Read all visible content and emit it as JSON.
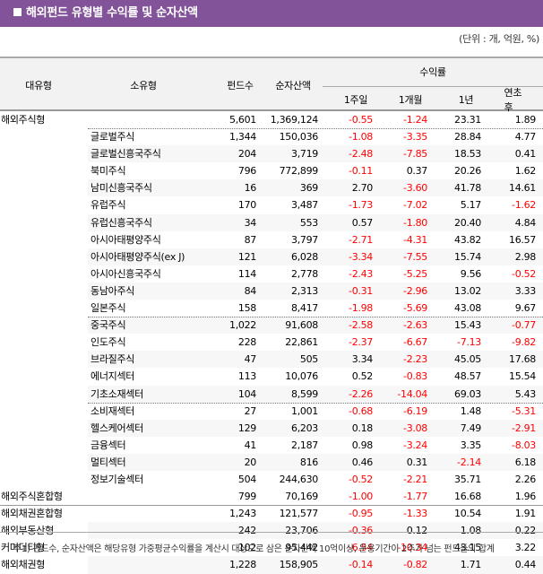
{
  "title": "해외펀드 유형별 수익률 및 순자산액",
  "unit": "(단위 : 개, 억원, %)",
  "colors": {
    "header_bar": "#83539a",
    "negative": "#ff0000"
  },
  "headers": {
    "major": "대유형",
    "minor": "소유형",
    "funds": "펀드수",
    "assets": "순자산액",
    "returns": "수익률",
    "w1": "1주일",
    "m1": "1개월",
    "y1": "1년",
    "ytd": "연초후"
  },
  "rows": [
    {
      "major": "해외주식형",
      "minor": "",
      "funds": "5,601",
      "assets": "1,369,124",
      "w1": "-0.55",
      "m1": "-1.24",
      "y1": "23.31",
      "ytd": "1.89"
    },
    {
      "major": "",
      "minor": "글로벌주식",
      "funds": "1,344",
      "assets": "150,036",
      "w1": "-1.08",
      "m1": "-3.35",
      "y1": "28.84",
      "ytd": "4.77"
    },
    {
      "major": "",
      "minor": "글로벌신흥국주식",
      "funds": "204",
      "assets": "3,719",
      "w1": "-2.48",
      "m1": "-7.85",
      "y1": "18.53",
      "ytd": "0.41"
    },
    {
      "major": "",
      "minor": "북미주식",
      "funds": "796",
      "assets": "772,899",
      "w1": "-0.11",
      "m1": "0.37",
      "y1": "20.26",
      "ytd": "1.62"
    },
    {
      "major": "",
      "minor": "남미신흥국주식",
      "funds": "16",
      "assets": "369",
      "w1": "2.70",
      "m1": "-3.60",
      "y1": "41.78",
      "ytd": "14.61"
    },
    {
      "major": "",
      "minor": "유럽주식",
      "funds": "170",
      "assets": "3,487",
      "w1": "-1.73",
      "m1": "-7.02",
      "y1": "5.17",
      "ytd": "-1.62"
    },
    {
      "major": "",
      "minor": "유럽신흥국주식",
      "funds": "34",
      "assets": "553",
      "w1": "0.57",
      "m1": "-1.80",
      "y1": "20.40",
      "ytd": "4.84"
    },
    {
      "major": "",
      "minor": "아시아태평양주식",
      "funds": "87",
      "assets": "3,797",
      "w1": "-2.71",
      "m1": "-4.31",
      "y1": "43.82",
      "ytd": "16.57"
    },
    {
      "major": "",
      "minor": "아시아태평양주식(ex J)",
      "funds": "121",
      "assets": "6,028",
      "w1": "-3.34",
      "m1": "-7.55",
      "y1": "15.74",
      "ytd": "2.98"
    },
    {
      "major": "",
      "minor": "아시아신흥국주식",
      "funds": "114",
      "assets": "2,778",
      "w1": "-2.43",
      "m1": "-5.25",
      "y1": "9.56",
      "ytd": "-0.52"
    },
    {
      "major": "",
      "minor": "동남아주식",
      "funds": "84",
      "assets": "2,313",
      "w1": "-0.31",
      "m1": "-2.96",
      "y1": "13.02",
      "ytd": "3.33"
    },
    {
      "major": "",
      "minor": "일본주식",
      "funds": "158",
      "assets": "8,417",
      "w1": "-1.98",
      "m1": "-5.69",
      "y1": "43.08",
      "ytd": "9.67"
    },
    {
      "major": "",
      "minor": "중국주식",
      "funds": "1,022",
      "assets": "91,608",
      "w1": "-2.58",
      "m1": "-2.63",
      "y1": "15.43",
      "ytd": "-0.77"
    },
    {
      "major": "",
      "minor": "인도주식",
      "funds": "228",
      "assets": "22,861",
      "w1": "-2.37",
      "m1": "-6.67",
      "y1": "-7.13",
      "ytd": "-9.82"
    },
    {
      "major": "",
      "minor": "브라질주식",
      "funds": "47",
      "assets": "505",
      "w1": "3.34",
      "m1": "-2.23",
      "y1": "45.05",
      "ytd": "17.68"
    },
    {
      "major": "",
      "minor": "에너지섹터",
      "funds": "113",
      "assets": "10,076",
      "w1": "0.52",
      "m1": "-0.83",
      "y1": "48.57",
      "ytd": "15.54"
    },
    {
      "major": "",
      "minor": "기초소재섹터",
      "funds": "104",
      "assets": "8,599",
      "w1": "-2.26",
      "m1": "-14.04",
      "y1": "69.03",
      "ytd": "5.43"
    },
    {
      "major": "",
      "minor": "소비재섹터",
      "funds": "27",
      "assets": "1,001",
      "w1": "-0.68",
      "m1": "-6.19",
      "y1": "1.48",
      "ytd": "-5.31"
    },
    {
      "major": "",
      "minor": "헬스케어섹터",
      "funds": "129",
      "assets": "6,203",
      "w1": "0.18",
      "m1": "-3.08",
      "y1": "7.49",
      "ytd": "-2.91"
    },
    {
      "major": "",
      "minor": "금융섹터",
      "funds": "41",
      "assets": "2,187",
      "w1": "0.98",
      "m1": "-3.24",
      "y1": "3.35",
      "ytd": "-8.03"
    },
    {
      "major": "",
      "minor": "멀티섹터",
      "funds": "20",
      "assets": "816",
      "w1": "0.46",
      "m1": "0.31",
      "y1": "-2.14",
      "ytd": "6.18"
    },
    {
      "major": "",
      "minor": "정보기술섹터",
      "funds": "504",
      "assets": "244,630",
      "w1": "-0.52",
      "m1": "-2.21",
      "y1": "35.71",
      "ytd": "2.26"
    },
    {
      "major": "해외주식혼합형",
      "minor": "",
      "funds": "799",
      "assets": "70,169",
      "w1": "-1.00",
      "m1": "-1.77",
      "y1": "16.68",
      "ytd": "1.96"
    },
    {
      "major": "해외채권혼합형",
      "minor": "",
      "funds": "1,243",
      "assets": "121,577",
      "w1": "-0.95",
      "m1": "-1.33",
      "y1": "10.54",
      "ytd": "1.91"
    },
    {
      "major": "해외부동산형",
      "minor": "",
      "funds": "242",
      "assets": "23,706",
      "w1": "-0.36",
      "m1": "0.12",
      "y1": "1.08",
      "ytd": "0.22"
    },
    {
      "major": "커머더티형",
      "minor": "",
      "funds": "102",
      "assets": "95,442",
      "w1": "-6.54",
      "m1": "-10.34",
      "y1": "43.15",
      "ytd": "3.22"
    },
    {
      "major": "해외채권형",
      "minor": "",
      "funds": "1,228",
      "assets": "158,905",
      "w1": "-0.14",
      "m1": "-0.82",
      "y1": "1.71",
      "ytd": "0.44"
    }
  ],
  "note": "주1) 펀드수, 순자산액은 해당유형 가중평균수익률을 계산시 대상으로 삼은 순자산액 10억이상, 운용기간이 2주가 넘는 펀드들의 합계"
}
